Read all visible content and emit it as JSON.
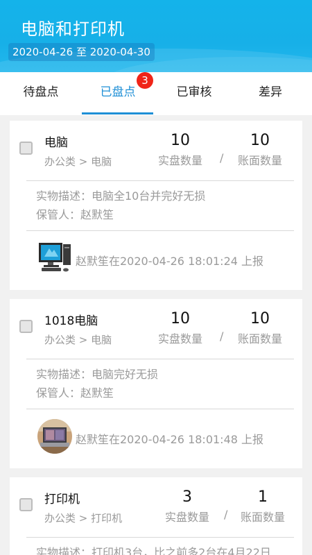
{
  "header": {
    "title": "电脑和打印机",
    "date_range": "2020-04-26 至 2020-04-30"
  },
  "tabs": [
    {
      "label": "待盘点"
    },
    {
      "label": "已盘点",
      "badge": "3",
      "active": true
    },
    {
      "label": "已审核"
    },
    {
      "label": "差异"
    }
  ],
  "items": [
    {
      "name": "电脑",
      "category": "办公类 > 电脑",
      "actual_count": "10",
      "actual_label": "实盘数量",
      "book_count": "10",
      "book_label": "账面数量",
      "slash": "/",
      "description": "实物描述：电脑全10台并完好无损",
      "keeper": "保管人：赵默笙",
      "report": "赵默笙在2020-04-26 18:01:24 上报",
      "thumb_icon": "desktop-computer-icon"
    },
    {
      "name": "1018电脑",
      "category": "办公类 > 电脑",
      "actual_count": "10",
      "actual_label": "实盘数量",
      "book_count": "10",
      "book_label": "账面数量",
      "slash": "/",
      "description": "实物描述：电脑完好无损",
      "keeper": "保管人：赵默笙",
      "report": "赵默笙在2020-04-26 18:01:48 上报",
      "thumb_icon": "laptop-photo-icon"
    },
    {
      "name": "打印机",
      "category": "办公类 > 打印机",
      "actual_count": "3",
      "actual_label": "实盘数量",
      "book_count": "1",
      "book_label": "账面数量",
      "slash": "/",
      "description": "实物描述：打印机3台，比之前多2台在4月22日"
    }
  ]
}
